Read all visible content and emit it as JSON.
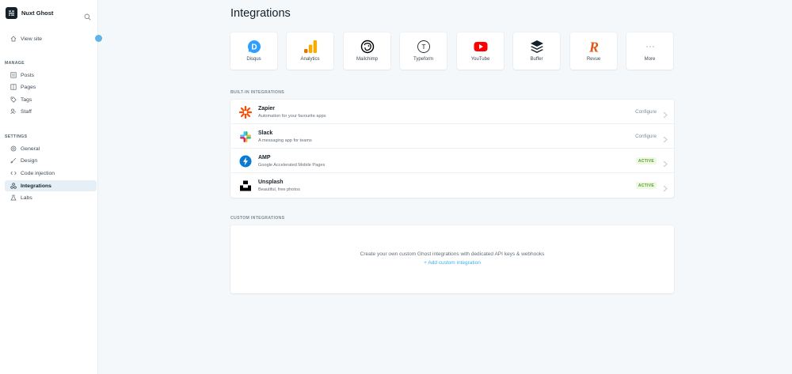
{
  "sidebar": {
    "brand_name": "Nuxt Ghost",
    "view_site": "View site",
    "manage_label": "MANAGE",
    "manage_items": [
      {
        "label": "Posts",
        "icon": "posts-icon"
      },
      {
        "label": "Pages",
        "icon": "pages-icon"
      },
      {
        "label": "Tags",
        "icon": "tag-icon"
      },
      {
        "label": "Staff",
        "icon": "staff-icon"
      }
    ],
    "settings_label": "SETTINGS",
    "settings_items": [
      {
        "label": "General",
        "icon": "gear-icon"
      },
      {
        "label": "Design",
        "icon": "brush-icon"
      },
      {
        "label": "Code injection",
        "icon": "code-icon"
      },
      {
        "label": "Integrations",
        "icon": "integrations-icon",
        "active": true
      },
      {
        "label": "Labs",
        "icon": "flask-icon"
      }
    ]
  },
  "main": {
    "title": "Integrations",
    "apps": [
      {
        "label": "Disqus",
        "icon": "disqus-icon",
        "color": "#2e9fff"
      },
      {
        "label": "Analytics",
        "icon": "analytics-icon",
        "color": "#f9ab00"
      },
      {
        "label": "Mailchimp",
        "icon": "mailchimp-icon",
        "color": "#000000"
      },
      {
        "label": "Typeform",
        "icon": "typeform-icon",
        "color": "#262627"
      },
      {
        "label": "YouTube",
        "icon": "youtube-icon",
        "color": "#ff0000"
      },
      {
        "label": "Buffer",
        "icon": "buffer-icon",
        "color": "#15212a"
      },
      {
        "label": "Revue",
        "icon": "revue-icon",
        "color": "#e15718"
      },
      {
        "label": "More",
        "icon": "more-icon",
        "color": "#c5d2d9"
      }
    ],
    "builtin_label": "BUILT-IN INTEGRATIONS",
    "builtin": [
      {
        "title": "Zapier",
        "description": "Automation for your favourite apps",
        "action": "Configure",
        "icon": "zapier-icon",
        "color": "#ff4a00"
      },
      {
        "title": "Slack",
        "description": "A messaging app for teams",
        "action": "Configure",
        "icon": "slack-icon"
      },
      {
        "title": "AMP",
        "description": "Google Accelerated Mobile Pages",
        "badge": "ACTIVE",
        "icon": "amp-icon",
        "color": "#0a7bd1"
      },
      {
        "title": "Unsplash",
        "description": "Beautiful, free photos",
        "badge": "ACTIVE",
        "icon": "unsplash-icon",
        "color": "#000000"
      }
    ],
    "custom_label": "CUSTOM INTEGRATIONS",
    "custom_text": "Create your own custom Ghost integrations with dedicated API keys & webhooks",
    "custom_link": "+ Add custom integration"
  }
}
